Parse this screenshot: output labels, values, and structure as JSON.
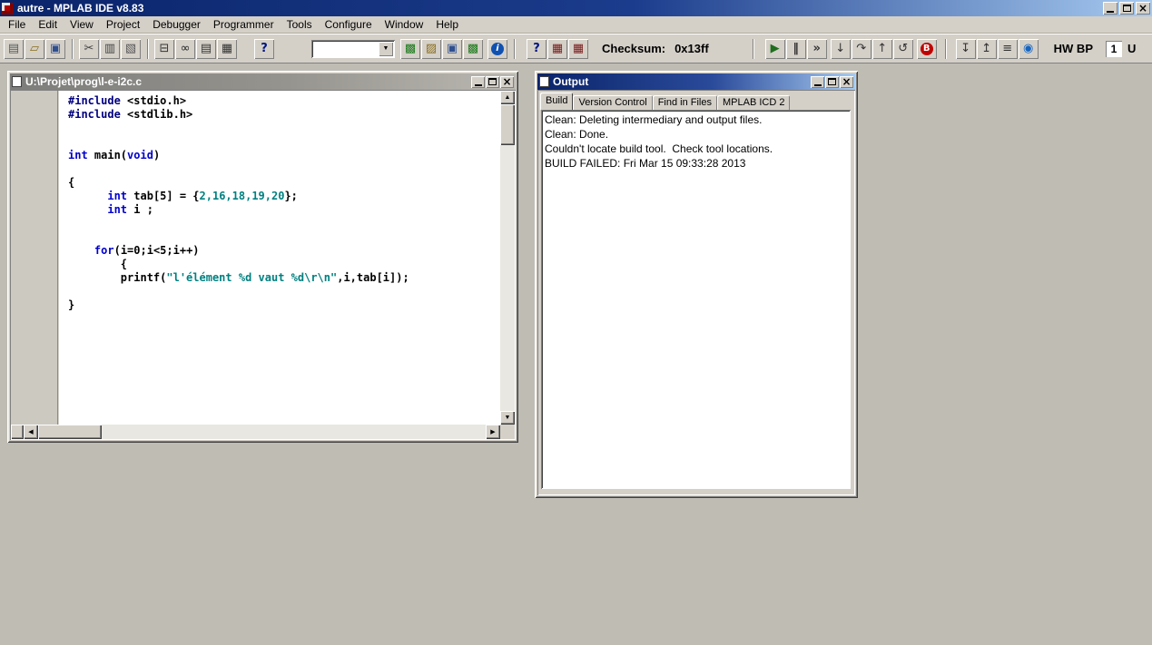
{
  "window": {
    "title": "autre - MPLAB IDE v8.83"
  },
  "menu": {
    "items": [
      "File",
      "Edit",
      "View",
      "Project",
      "Debugger",
      "Programmer",
      "Tools",
      "Configure",
      "Window",
      "Help"
    ]
  },
  "toolbar": {
    "items": [
      {
        "type": "btn",
        "name": "new-file-button",
        "glyph": "▤",
        "color": "#5a5a5a",
        "ml": 4
      },
      {
        "type": "btn",
        "name": "open-file-button",
        "glyph": "▱",
        "color": "#8a6d1a"
      },
      {
        "type": "btn",
        "name": "save-file-button",
        "glyph": "▣",
        "color": "#2f4f8f"
      },
      {
        "type": "sep"
      },
      {
        "type": "btn",
        "name": "cut-button",
        "glyph": "✂",
        "color": "#444444"
      },
      {
        "type": "btn",
        "name": "copy-button",
        "glyph": "▥",
        "color": "#444444"
      },
      {
        "type": "btn",
        "name": "paste-button",
        "glyph": "▧",
        "color": "#555555"
      },
      {
        "type": "sep"
      },
      {
        "type": "btn",
        "name": "print-button",
        "glyph": "⊟",
        "color": "#333333"
      },
      {
        "type": "btn",
        "name": "find-button",
        "glyph": "∞",
        "color": "#222222"
      },
      {
        "type": "btn",
        "name": "print-preview-button",
        "glyph": "▤",
        "color": "#333333"
      },
      {
        "type": "btn",
        "name": "properties-button",
        "glyph": "▦",
        "color": "#333333"
      },
      {
        "type": "btn",
        "name": "help-button",
        "glyph": "?",
        "color": "#00137f",
        "bold": true,
        "ml": 18
      },
      {
        "type": "combo",
        "name": "toolbar-combo",
        "value": "",
        "ml": 40
      },
      {
        "type": "btn",
        "name": "new-project-button",
        "glyph": "▩",
        "color": "#1b7a1b",
        "ml": 6
      },
      {
        "type": "btn",
        "name": "open-project-button",
        "glyph": "▨",
        "color": "#8a6d1a"
      },
      {
        "type": "btn",
        "name": "save-workspace-button",
        "glyph": "▣",
        "color": "#2f4f8f"
      },
      {
        "type": "btn",
        "name": "build-all-button",
        "glyph": "▩",
        "color": "#1b7a1b"
      },
      {
        "type": "btn",
        "name": "build-info-button",
        "glyph": "i",
        "variant": "circle-blue",
        "ml": 4
      },
      {
        "type": "sep",
        "ml": 6
      },
      {
        "type": "btn",
        "name": "context-help-button",
        "glyph": "?",
        "color": "#00137f",
        "bold": true,
        "ml": 6
      },
      {
        "type": "btn",
        "name": "checksum-window-button",
        "glyph": "▦",
        "color": "#7a1b1b"
      },
      {
        "type": "btn",
        "name": "memory-window-button",
        "glyph": "▦",
        "color": "#7a1b1b"
      },
      {
        "type": "label",
        "name": "checksum-label",
        "text": "Checksum:",
        "ml": 14
      },
      {
        "type": "label",
        "name": "checksum-value",
        "text": "0x13ff",
        "ml": 10
      },
      {
        "type": "sep",
        "ml": 48
      },
      {
        "type": "btn",
        "name": "run-button",
        "glyph": "▶",
        "color": "#1e6e1e",
        "ml": 6
      },
      {
        "type": "btn",
        "name": "halt-button",
        "glyph": "‖",
        "color": "#333333",
        "bold": true
      },
      {
        "type": "btn",
        "name": "animate-button",
        "glyph": "»",
        "color": "#333333",
        "bold": true
      },
      {
        "type": "btn",
        "name": "step-into-button",
        "glyph": "↓",
        "color": "#333333",
        "ml": 3
      },
      {
        "type": "btn",
        "name": "step-over-button",
        "glyph": "↷",
        "color": "#333333"
      },
      {
        "type": "btn",
        "name": "step-out-button",
        "glyph": "↑",
        "color": "#333333"
      },
      {
        "type": "btn",
        "name": "reset-button",
        "glyph": "↺",
        "color": "#333333"
      },
      {
        "type": "btn",
        "name": "breakpoints-button",
        "glyph": "B",
        "variant": "circle-red",
        "ml": 3
      },
      {
        "type": "sep",
        "ml": 8
      },
      {
        "type": "btn",
        "name": "program-target-button",
        "glyph": "↧",
        "color": "#333333",
        "ml": 4
      },
      {
        "type": "btn",
        "name": "read-target-button",
        "glyph": "↥",
        "color": "#333333"
      },
      {
        "type": "btn",
        "name": "verify-target-button",
        "glyph": "≡",
        "color": "#333333"
      },
      {
        "type": "btn",
        "name": "target-device-button",
        "glyph": "◉",
        "color": "#1565c0"
      },
      {
        "type": "label",
        "name": "hw-bp-label",
        "text": "HW BP",
        "ml": 16
      },
      {
        "type": "box",
        "name": "hw-bp-count",
        "text": "1",
        "ml": 14
      },
      {
        "type": "label",
        "name": "hw-bp-partial-label",
        "text": "U",
        "ml": 6
      }
    ]
  },
  "editor": {
    "title": "U:\\Projet\\prog\\l-e-i2c.c",
    "code_lines": [
      [
        {
          "t": "#include ",
          "s": "pp"
        },
        {
          "t": "<stdio.h>",
          "s": "pl"
        }
      ],
      [
        {
          "t": "#include ",
          "s": "pp"
        },
        {
          "t": "<stdlib.h>",
          "s": "pl"
        }
      ],
      [],
      [],
      [
        {
          "t": "int",
          "s": "kw"
        },
        {
          "t": " main(",
          "s": "pl"
        },
        {
          "t": "void",
          "s": "kw"
        },
        {
          "t": ")",
          "s": "pl"
        }
      ],
      [],
      [
        {
          "t": "{",
          "s": "pl"
        }
      ],
      [
        {
          "t": "      ",
          "s": "pl"
        },
        {
          "t": "int",
          "s": "kw"
        },
        {
          "t": " tab[5] = {",
          "s": "pl"
        },
        {
          "t": "2,16,18,19,20",
          "s": "num"
        },
        {
          "t": "};",
          "s": "pl"
        }
      ],
      [
        {
          "t": "      ",
          "s": "pl"
        },
        {
          "t": "int",
          "s": "kw"
        },
        {
          "t": " i ;",
          "s": "pl"
        }
      ],
      [],
      [],
      [
        {
          "t": "    ",
          "s": "pl"
        },
        {
          "t": "for",
          "s": "kw"
        },
        {
          "t": "(i=0;i<5;i++)",
          "s": "pl"
        }
      ],
      [
        {
          "t": "        {",
          "s": "pl"
        }
      ],
      [
        {
          "t": "        printf(",
          "s": "pl"
        },
        {
          "t": "\"l'élément %d vaut %d\\r\\n\"",
          "s": "str"
        },
        {
          "t": ",i,tab[i]);",
          "s": "pl"
        }
      ],
      [],
      [
        {
          "t": "}",
          "s": "pl"
        }
      ]
    ]
  },
  "output": {
    "title": "Output",
    "tabs": [
      {
        "label": "Build",
        "active": true
      },
      {
        "label": "Version Control",
        "active": false
      },
      {
        "label": "Find in Files",
        "active": false
      },
      {
        "label": "MPLAB ICD 2",
        "active": false
      }
    ],
    "lines": [
      "Clean: Deleting intermediary and output files.",
      "Clean: Done.",
      "Couldn't locate build tool.  Check tool locations.",
      "BUILD FAILED: Fri Mar 15 09:33:28 2013"
    ]
  }
}
